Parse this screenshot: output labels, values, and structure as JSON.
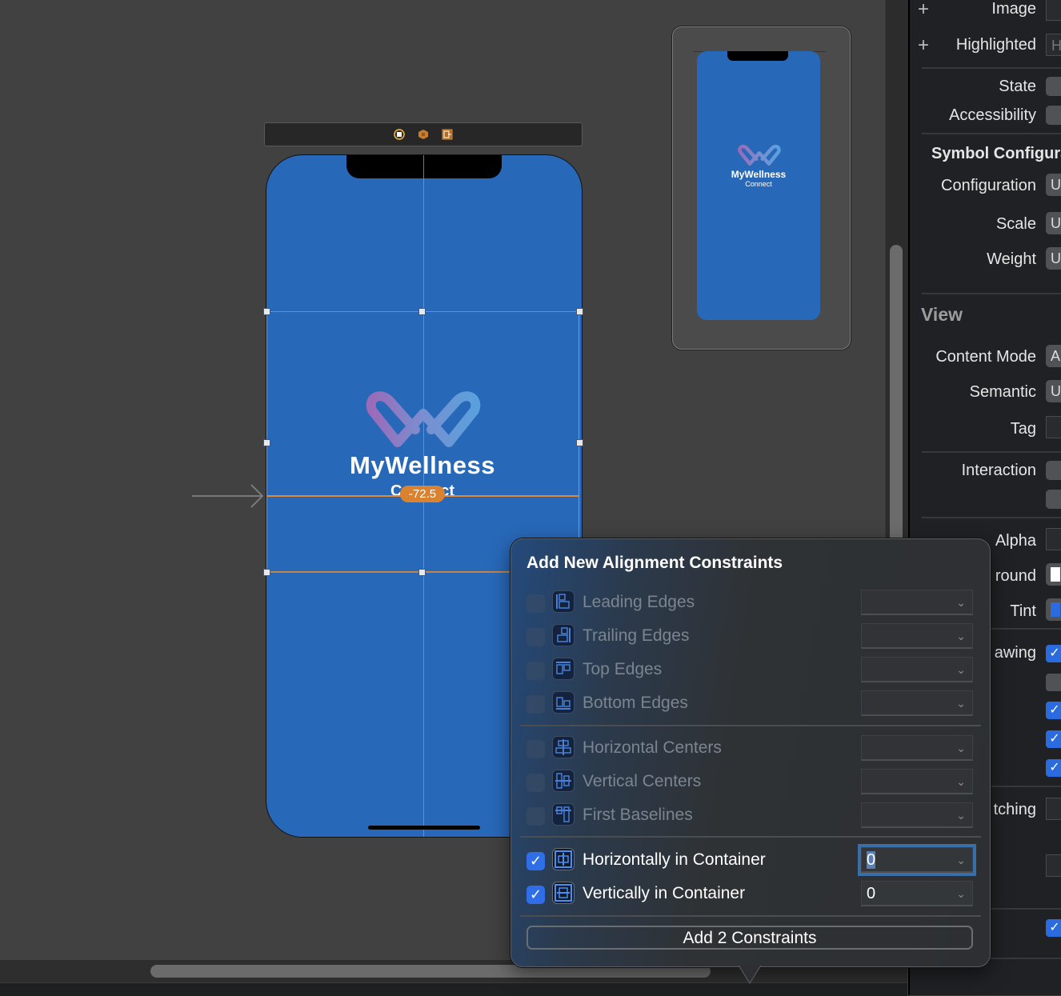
{
  "canvas": {
    "scene_dock_icons": [
      "view-controller-icon",
      "first-responder-icon",
      "exit-icon"
    ],
    "main_screen": {
      "app_title": "MyWellness",
      "app_subtitle": "Connect",
      "constraint_constant_badge": "-72.5",
      "background_color": "#2868b8",
      "selection_color": "#c88a4d",
      "guide_color": "#e0873a"
    },
    "preview": {
      "app_title": "MyWellness",
      "app_subtitle": "Connect"
    }
  },
  "inspector": {
    "image_label": "Image",
    "highlighted_label": "Highlighted",
    "highlighted_value": "H",
    "state_label": "State",
    "accessibility_label": "Accessibility",
    "symbol_section": "Symbol Configuration",
    "configuration_label": "Configuration",
    "configuration_value": "U",
    "scale_label": "Scale",
    "scale_value": "U",
    "weight_label": "Weight",
    "weight_value": "U",
    "view_section": "View",
    "content_mode_label": "Content Mode",
    "content_mode_value": "A",
    "semantic_label": "Semantic",
    "semantic_value": "U",
    "tag_label": "Tag",
    "interaction_label": "Interaction",
    "alpha_label": "Alpha",
    "background_label": "round",
    "tint_label": "Tint",
    "drawing_label": "awing",
    "stretching_label": "tching",
    "check_mark": "✓"
  },
  "popover": {
    "title": "Add New Alignment Constraints",
    "chevron": "⌄",
    "check_mark": "✓",
    "edge_items": [
      {
        "label": "Leading Edges",
        "checked": false,
        "value": ""
      },
      {
        "label": "Trailing Edges",
        "checked": false,
        "value": ""
      },
      {
        "label": "Top Edges",
        "checked": false,
        "value": ""
      },
      {
        "label": "Bottom Edges",
        "checked": false,
        "value": ""
      }
    ],
    "center_items": [
      {
        "label": "Horizontal Centers",
        "checked": false,
        "value": ""
      },
      {
        "label": "Vertical Centers",
        "checked": false,
        "value": ""
      },
      {
        "label": "First Baselines",
        "checked": false,
        "value": ""
      }
    ],
    "container_items": [
      {
        "label": "Horizontally in Container",
        "checked": true,
        "value": "0"
      },
      {
        "label": "Vertically in Container",
        "checked": true,
        "value": "0"
      }
    ],
    "add_button_label": "Add 2 Constraints"
  }
}
